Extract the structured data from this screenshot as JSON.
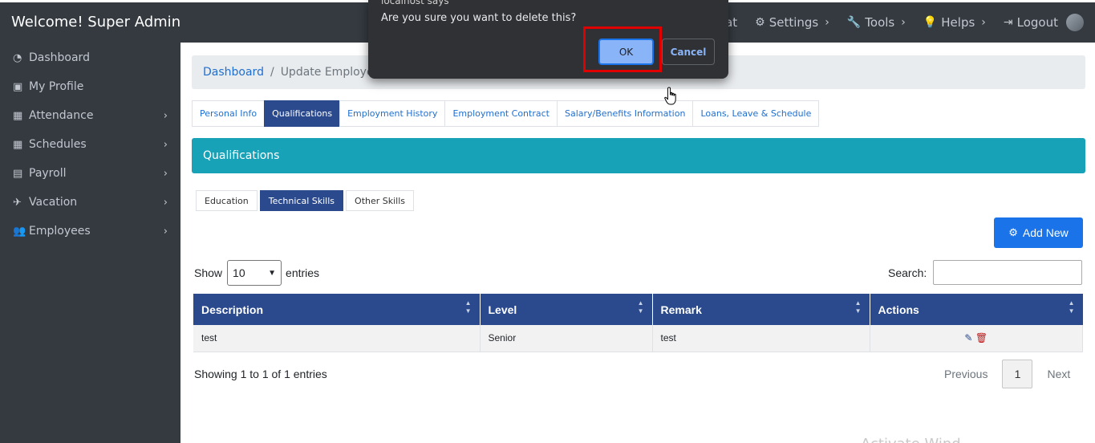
{
  "header": {
    "brand": "Welcome! Super Admin",
    "nav": [
      {
        "label": "at",
        "icon": "chat-icon"
      },
      {
        "label": "Settings",
        "icon": "gears-icon"
      },
      {
        "label": "Tools",
        "icon": "wrench-icon"
      },
      {
        "label": "Helps",
        "icon": "lightbulb-icon"
      },
      {
        "label": "Logout",
        "icon": "logout-icon"
      }
    ]
  },
  "sidebar": {
    "items": [
      {
        "label": "Dashboard",
        "icon": "dashboard-icon"
      },
      {
        "label": "My Profile",
        "icon": "id-card-icon"
      },
      {
        "label": "Attendance",
        "icon": "calendar-icon"
      },
      {
        "label": "Schedules",
        "icon": "calendar-grid-icon"
      },
      {
        "label": "Payroll",
        "icon": "file-icon"
      },
      {
        "label": "Vacation",
        "icon": "plane-icon"
      },
      {
        "label": "Employees",
        "icon": "users-icon"
      }
    ]
  },
  "breadcrumb": {
    "home": "Dashboard",
    "separator": "/",
    "current": "Update Employee"
  },
  "tabs": [
    {
      "label": "Personal Info"
    },
    {
      "label": "Qualifications"
    },
    {
      "label": "Employment History"
    },
    {
      "label": "Employment Contract"
    },
    {
      "label": "Salary/Benefits Information"
    },
    {
      "label": "Loans, Leave & Schedule"
    }
  ],
  "panel": {
    "title": "Qualifications"
  },
  "subtabs": [
    {
      "label": "Education"
    },
    {
      "label": "Technical Skills"
    },
    {
      "label": "Other Skills"
    }
  ],
  "add_new": {
    "label": "Add New"
  },
  "table_controls": {
    "show_label": "Show",
    "entries_label": "entries",
    "page_size": "10",
    "search_label": "Search:",
    "search_value": ""
  },
  "table": {
    "headers": [
      "Description",
      "Level",
      "Remark",
      "Actions"
    ],
    "rows": [
      {
        "description": "test",
        "level": "Senior",
        "remark": "test"
      }
    ]
  },
  "footer": {
    "info": "Showing 1 to 1 of 1 entries",
    "previous": "Previous",
    "page": "1",
    "next": "Next"
  },
  "watermark": "Activate Wind",
  "dialog": {
    "origin": "localhost says",
    "message": "Are you sure you want to delete this?",
    "ok": "OK",
    "cancel": "Cancel"
  },
  "colors": {
    "sidebar_bg": "#343a40",
    "primary_dark": "#2a4a8d",
    "teal": "#17a2b8",
    "blue_button": "#1a73e8",
    "highlight": "#e00000"
  }
}
